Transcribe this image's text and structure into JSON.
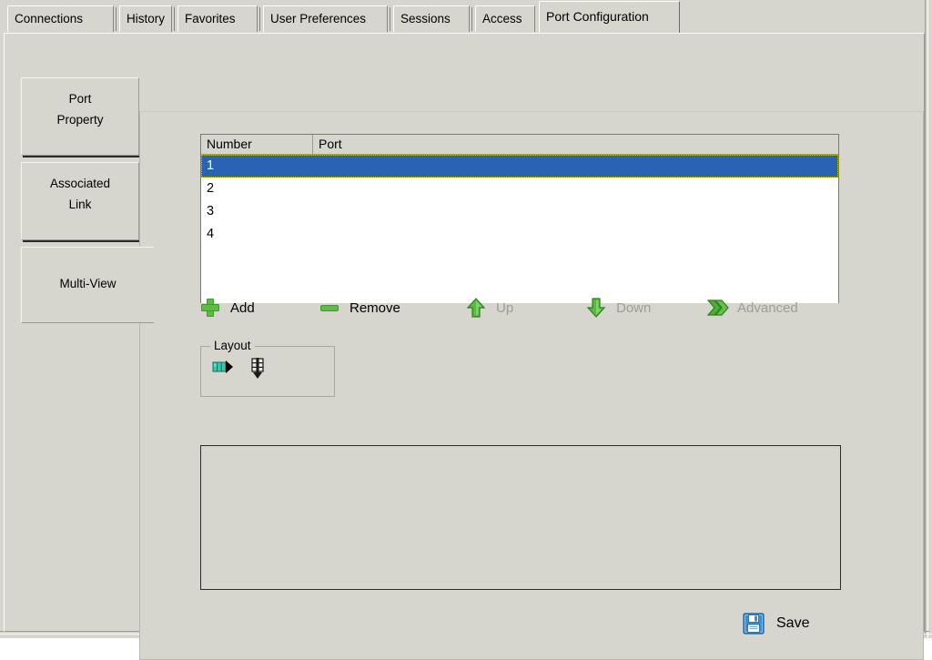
{
  "window": {
    "background_color": "#d6d6ce"
  },
  "tabs": {
    "items": [
      {
        "label": "Connections",
        "active": false
      },
      {
        "label": "History",
        "active": false
      },
      {
        "label": "Favorites",
        "active": false
      },
      {
        "label": "User Preferences",
        "active": false
      },
      {
        "label": "Sessions",
        "active": false
      },
      {
        "label": "Access",
        "active": false
      },
      {
        "label": "Port Configuration",
        "active": true
      }
    ]
  },
  "side_tabs": {
    "items": [
      {
        "label_line1": "Port",
        "label_line2": "Property",
        "active": false
      },
      {
        "label_line1": "Associated",
        "label_line2": "Link",
        "active": false
      },
      {
        "label_line1": "Multi-View",
        "label_line2": "",
        "active": true
      }
    ]
  },
  "list": {
    "columns": [
      "Number",
      "Port"
    ],
    "rows": [
      {
        "number": "1",
        "port": "",
        "selected": true
      },
      {
        "number": "2",
        "port": "",
        "selected": false
      },
      {
        "number": "3",
        "port": "",
        "selected": false
      },
      {
        "number": "4",
        "port": "",
        "selected": false
      }
    ],
    "selection_color": "#2a63b4"
  },
  "toolbar": {
    "items": [
      {
        "label": "Add",
        "icon": "plus-icon",
        "enabled": true
      },
      {
        "label": "Remove",
        "icon": "minus-icon",
        "enabled": true
      },
      {
        "label": "Up",
        "icon": "arrow-up-icon",
        "enabled": false
      },
      {
        "label": "Down",
        "icon": "arrow-down-icon",
        "enabled": false
      },
      {
        "label": "Advanced",
        "icon": "double-chevron-right-icon",
        "enabled": false
      }
    ]
  },
  "layout_group": {
    "title": "Layout",
    "buttons": [
      {
        "icon": "layout-horizontal-icon"
      },
      {
        "icon": "layout-vertical-icon"
      }
    ]
  },
  "preview": {
    "content": ""
  },
  "save": {
    "label": "Save",
    "icon": "save-floppy-icon"
  }
}
